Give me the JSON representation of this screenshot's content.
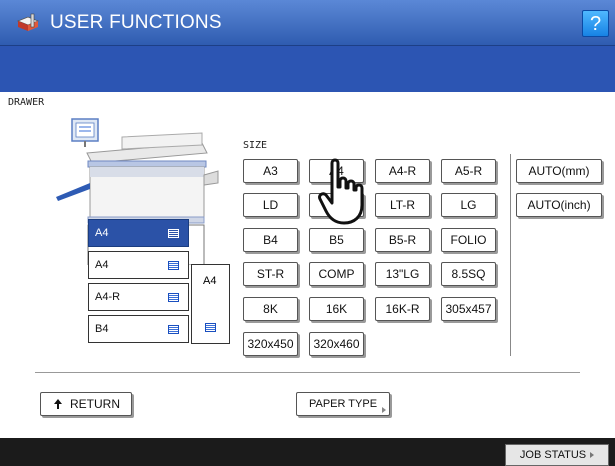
{
  "header": {
    "title": "USER FUNCTIONS",
    "help_label": "?"
  },
  "drawer_label": "DRAWER",
  "size_label": "SIZE",
  "drawers": [
    {
      "label": "A4",
      "selected": true
    },
    {
      "label": "A4",
      "selected": false
    },
    {
      "label": "A4-R",
      "selected": false
    },
    {
      "label": "B4",
      "selected": false
    }
  ],
  "bypass": {
    "label": "A4"
  },
  "sizes": [
    [
      "A3",
      "A4",
      "A4-R",
      "A5-R"
    ],
    [
      "LD",
      "LT",
      "LT-R",
      "LG"
    ],
    [
      "B4",
      "B5",
      "B5-R",
      "FOLIO"
    ],
    [
      "ST-R",
      "COMP",
      "13\"LG",
      "8.5SQ"
    ],
    [
      "8K",
      "16K",
      "16K-R",
      "305x457"
    ],
    [
      "320x450",
      "320x460"
    ]
  ],
  "auto_buttons": [
    "AUTO(mm)",
    "AUTO(inch)"
  ],
  "footer": {
    "return_label": "RETURN",
    "paper_type_label": "PAPER TYPE",
    "job_status_label": "JOB STATUS"
  },
  "colors": {
    "header_blue": "#2f5cb0",
    "selected_drawer": "#2b52a7",
    "help_button": "#1782e4"
  }
}
